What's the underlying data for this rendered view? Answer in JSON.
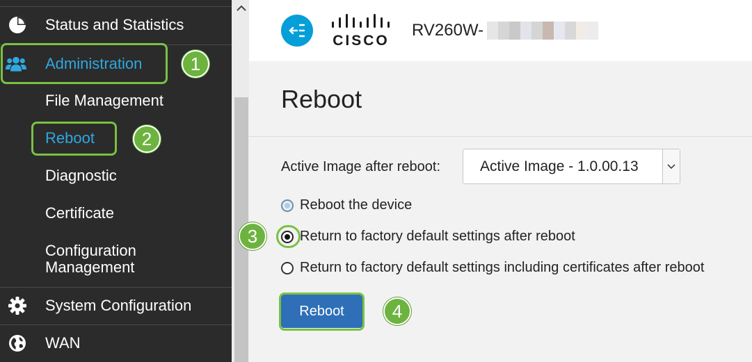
{
  "sidebar": {
    "status_label": "Status and Statistics",
    "admin_label": "Administration",
    "sub_items": [
      "File Management",
      "Reboot",
      "Diagnostic",
      "Certificate"
    ],
    "config_mgmt_line1": "Configuration",
    "config_mgmt_line2": "Management",
    "sysconfig_label": "System Configuration",
    "wan_label": "WAN"
  },
  "header": {
    "device_name": "RV260W-"
  },
  "main": {
    "title": "Reboot",
    "image_label": "Active Image after reboot:",
    "image_selected": "Active Image - 1.0.00.13",
    "radio_options": [
      "Reboot the device",
      "Return to factory default settings after reboot",
      "Return to factory default settings including certificates after reboot"
    ],
    "selected_option": 1,
    "reboot_button": "Reboot"
  },
  "steps": [
    "1",
    "2",
    "3",
    "4"
  ],
  "colors": {
    "sidebar_bg": "#2b2b2b",
    "active_text": "#2fa8e0",
    "highlight": "#7ac143",
    "step_badge": "#6db33f",
    "primary_button": "#2e6fb7",
    "app_badge": "#049fd9"
  }
}
